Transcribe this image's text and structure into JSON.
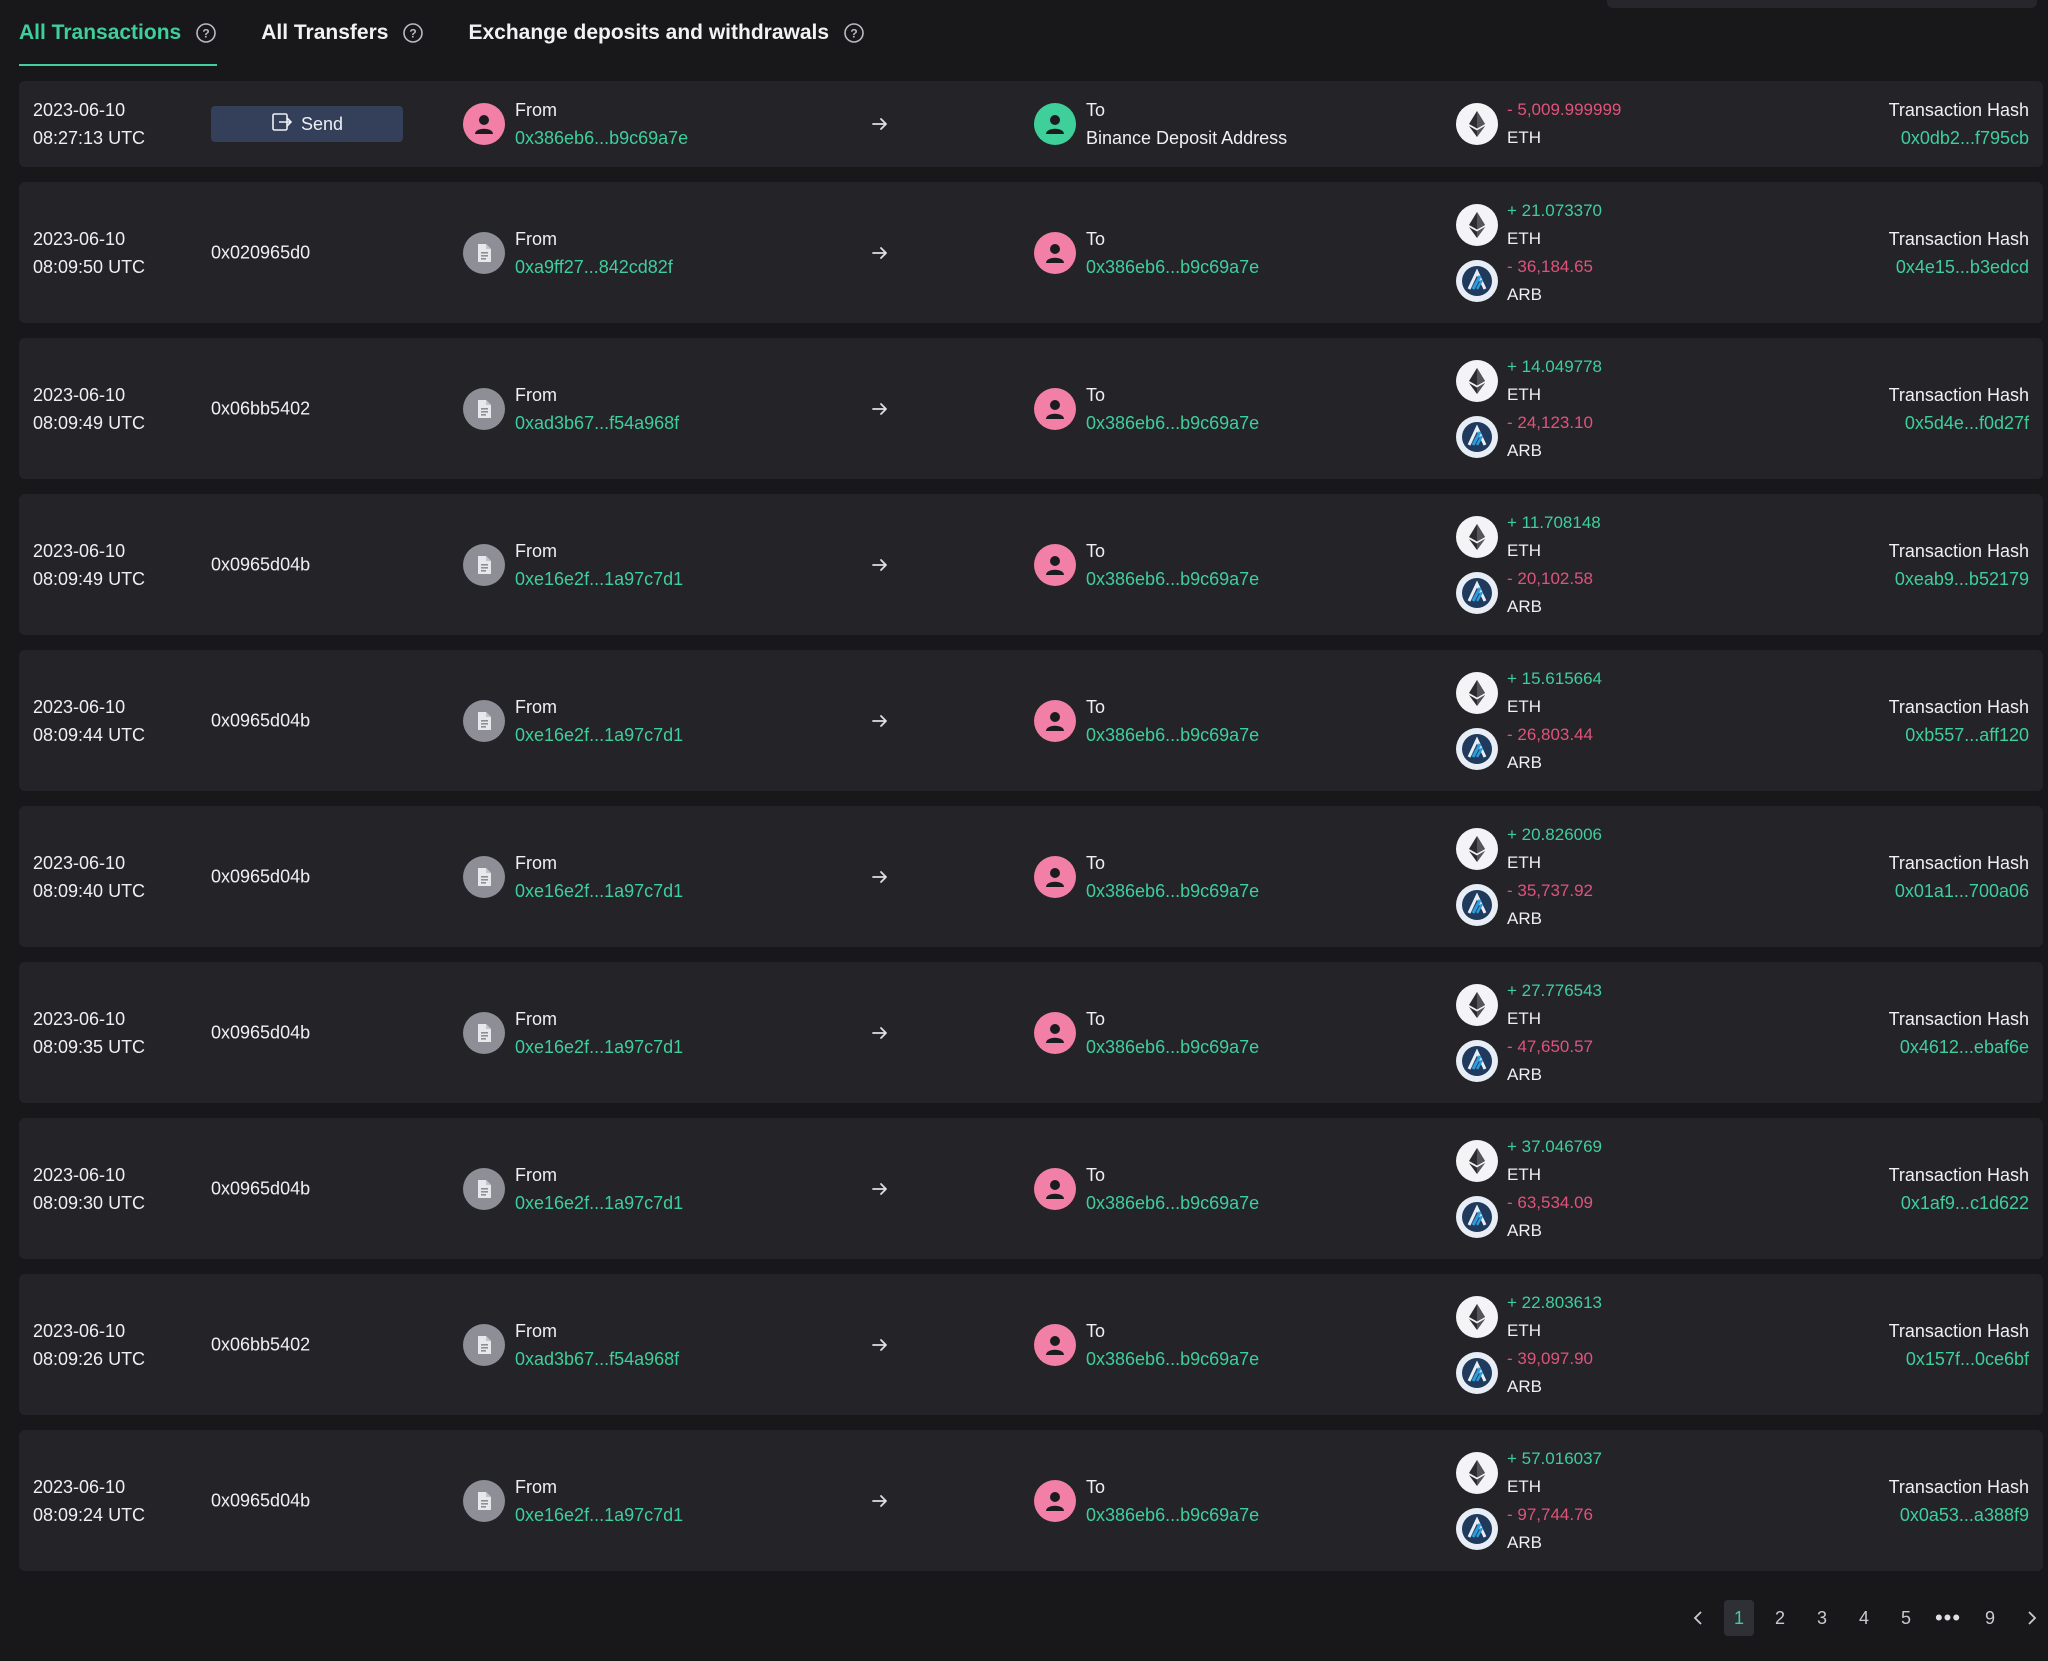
{
  "tabs": [
    {
      "label": "All Transactions",
      "active": true
    },
    {
      "label": "All Transfers",
      "active": false
    },
    {
      "label": "Exchange deposits and withdrawals",
      "active": false
    }
  ],
  "colors": {
    "accent": "#3ecf9b",
    "negative": "#e0537a",
    "avatar_pink": "#f17fa6"
  },
  "rows": [
    {
      "date": "2023-06-10",
      "time": "08:27:13 UTC",
      "method": "Send",
      "method_is_button": true,
      "from_label": "From",
      "from_addr": "0x386eb6...b9c69a7e",
      "from_avatar": "user-pink",
      "to_label": "To",
      "to_addr": "Binance Deposit Address",
      "to_avatar": "user-teal",
      "to_plain": true,
      "amounts": [
        {
          "value": "- 5,009.999999",
          "token": "ETH",
          "sign": "neg",
          "icon": "eth"
        }
      ],
      "hash_label": "Transaction Hash",
      "hash": "0x0db2...f795cb"
    },
    {
      "date": "2023-06-10",
      "time": "08:09:50 UTC",
      "method": "0x020965d0",
      "from_label": "From",
      "from_addr": "0xa9ff27...842cd82f",
      "from_avatar": "contract",
      "to_label": "To",
      "to_addr": "0x386eb6...b9c69a7e",
      "to_avatar": "user-pink",
      "amounts": [
        {
          "value": "+ 21.073370",
          "token": "ETH",
          "sign": "pos",
          "icon": "eth"
        },
        {
          "value": "- 36,184.65",
          "token": "ARB",
          "sign": "neg",
          "icon": "arb"
        }
      ],
      "hash_label": "Transaction Hash",
      "hash": "0x4e15...b3edcd"
    },
    {
      "date": "2023-06-10",
      "time": "08:09:49 UTC",
      "method": "0x06bb5402",
      "from_label": "From",
      "from_addr": "0xad3b67...f54a968f",
      "from_avatar": "contract",
      "to_label": "To",
      "to_addr": "0x386eb6...b9c69a7e",
      "to_avatar": "user-pink",
      "amounts": [
        {
          "value": "+ 14.049778",
          "token": "ETH",
          "sign": "pos",
          "icon": "eth"
        },
        {
          "value": "- 24,123.10",
          "token": "ARB",
          "sign": "neg",
          "icon": "arb"
        }
      ],
      "hash_label": "Transaction Hash",
      "hash": "0x5d4e...f0d27f"
    },
    {
      "date": "2023-06-10",
      "time": "08:09:49 UTC",
      "method": "0x0965d04b",
      "from_label": "From",
      "from_addr": "0xe16e2f...1a97c7d1",
      "from_avatar": "contract",
      "to_label": "To",
      "to_addr": "0x386eb6...b9c69a7e",
      "to_avatar": "user-pink",
      "amounts": [
        {
          "value": "+ 11.708148",
          "token": "ETH",
          "sign": "pos",
          "icon": "eth"
        },
        {
          "value": "- 20,102.58",
          "token": "ARB",
          "sign": "neg",
          "icon": "arb"
        }
      ],
      "hash_label": "Transaction Hash",
      "hash": "0xeab9...b52179"
    },
    {
      "date": "2023-06-10",
      "time": "08:09:44 UTC",
      "method": "0x0965d04b",
      "from_label": "From",
      "from_addr": "0xe16e2f...1a97c7d1",
      "from_avatar": "contract",
      "to_label": "To",
      "to_addr": "0x386eb6...b9c69a7e",
      "to_avatar": "user-pink",
      "amounts": [
        {
          "value": "+ 15.615664",
          "token": "ETH",
          "sign": "pos",
          "icon": "eth"
        },
        {
          "value": "- 26,803.44",
          "token": "ARB",
          "sign": "neg",
          "icon": "arb"
        }
      ],
      "hash_label": "Transaction Hash",
      "hash": "0xb557...aff120"
    },
    {
      "date": "2023-06-10",
      "time": "08:09:40 UTC",
      "method": "0x0965d04b",
      "from_label": "From",
      "from_addr": "0xe16e2f...1a97c7d1",
      "from_avatar": "contract",
      "to_label": "To",
      "to_addr": "0x386eb6...b9c69a7e",
      "to_avatar": "user-pink",
      "amounts": [
        {
          "value": "+ 20.826006",
          "token": "ETH",
          "sign": "pos",
          "icon": "eth"
        },
        {
          "value": "- 35,737.92",
          "token": "ARB",
          "sign": "neg",
          "icon": "arb"
        }
      ],
      "hash_label": "Transaction Hash",
      "hash": "0x01a1...700a06"
    },
    {
      "date": "2023-06-10",
      "time": "08:09:35 UTC",
      "method": "0x0965d04b",
      "from_label": "From",
      "from_addr": "0xe16e2f...1a97c7d1",
      "from_avatar": "contract",
      "to_label": "To",
      "to_addr": "0x386eb6...b9c69a7e",
      "to_avatar": "user-pink",
      "amounts": [
        {
          "value": "+ 27.776543",
          "token": "ETH",
          "sign": "pos",
          "icon": "eth"
        },
        {
          "value": "- 47,650.57",
          "token": "ARB",
          "sign": "neg",
          "icon": "arb"
        }
      ],
      "hash_label": "Transaction Hash",
      "hash": "0x4612...ebaf6e"
    },
    {
      "date": "2023-06-10",
      "time": "08:09:30 UTC",
      "method": "0x0965d04b",
      "from_label": "From",
      "from_addr": "0xe16e2f...1a97c7d1",
      "from_avatar": "contract",
      "to_label": "To",
      "to_addr": "0x386eb6...b9c69a7e",
      "to_avatar": "user-pink",
      "amounts": [
        {
          "value": "+ 37.046769",
          "token": "ETH",
          "sign": "pos",
          "icon": "eth"
        },
        {
          "value": "- 63,534.09",
          "token": "ARB",
          "sign": "neg",
          "icon": "arb"
        }
      ],
      "hash_label": "Transaction Hash",
      "hash": "0x1af9...c1d622"
    },
    {
      "date": "2023-06-10",
      "time": "08:09:26 UTC",
      "method": "0x06bb5402",
      "from_label": "From",
      "from_addr": "0xad3b67...f54a968f",
      "from_avatar": "contract",
      "to_label": "To",
      "to_addr": "0x386eb6...b9c69a7e",
      "to_avatar": "user-pink",
      "amounts": [
        {
          "value": "+ 22.803613",
          "token": "ETH",
          "sign": "pos",
          "icon": "eth"
        },
        {
          "value": "- 39,097.90",
          "token": "ARB",
          "sign": "neg",
          "icon": "arb"
        }
      ],
      "hash_label": "Transaction Hash",
      "hash": "0x157f...0ce6bf"
    },
    {
      "date": "2023-06-10",
      "time": "08:09:24 UTC",
      "method": "0x0965d04b",
      "from_label": "From",
      "from_addr": "0xe16e2f...1a97c7d1",
      "from_avatar": "contract",
      "to_label": "To",
      "to_addr": "0x386eb6...b9c69a7e",
      "to_avatar": "user-pink",
      "amounts": [
        {
          "value": "+ 57.016037",
          "token": "ETH",
          "sign": "pos",
          "icon": "eth"
        },
        {
          "value": "- 97,744.76",
          "token": "ARB",
          "sign": "neg",
          "icon": "arb"
        }
      ],
      "hash_label": "Transaction Hash",
      "hash": "0x0a53...a388f9"
    }
  ],
  "pagination": {
    "pages": [
      "1",
      "2",
      "3",
      "4",
      "5",
      "•••",
      "9"
    ],
    "current": "1"
  }
}
